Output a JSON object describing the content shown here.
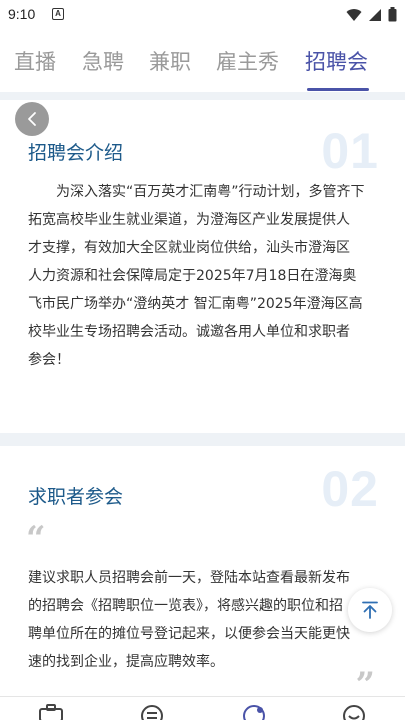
{
  "status_bar": {
    "time": "9:10",
    "app_icon_letter": "A",
    "icons": [
      "wifi-icon",
      "signal-icon",
      "battery-icon"
    ]
  },
  "tabs": [
    {
      "label": "直播",
      "active": false
    },
    {
      "label": "急聘",
      "active": false
    },
    {
      "label": "兼职",
      "active": false
    },
    {
      "label": "雇主秀",
      "active": false
    },
    {
      "label": "招聘会",
      "active": true
    }
  ],
  "sections": [
    {
      "number": "01",
      "title": "招聘会介绍",
      "lines": [
        "为深入落实“百万英才汇南粤”行动计划，多管齐下",
        "拓宽高校毕业生就业渠道，为澄海区产业发展提供人",
        "才支撑，有效加大全区就业岗位供给，汕头市澄海区",
        "人力资源和社会保障局定于2025年7月18日在澄海奥",
        "飞市民广场举办“澄纳英才 智汇南粤”2025年澄海区高",
        "校毕业生专场招聘会活动。诚邀各用人单位和求职者",
        "参会！"
      ]
    },
    {
      "number": "02",
      "title": "求职者参会",
      "quote_open": "“",
      "quote_close": "”",
      "lines": [
        "建议求职人员招聘会前一天，登陆本站查看最新发布",
        "的招聘会《招聘职位一览表》，将感兴趣的职位和招",
        "聘单位所在的摊位号登记起来，以便参会当天能更快",
        "速的找到企业，提高应聘效率。"
      ]
    }
  ],
  "colors": {
    "accent": "#4a53a8",
    "title": "#1d5a8a",
    "background": "#eef2f6",
    "tab_inactive": "#9a9a9a"
  },
  "bottom_nav": {
    "icons": [
      "briefcase-icon",
      "message-icon",
      "fair-icon",
      "profile-icon"
    ]
  }
}
